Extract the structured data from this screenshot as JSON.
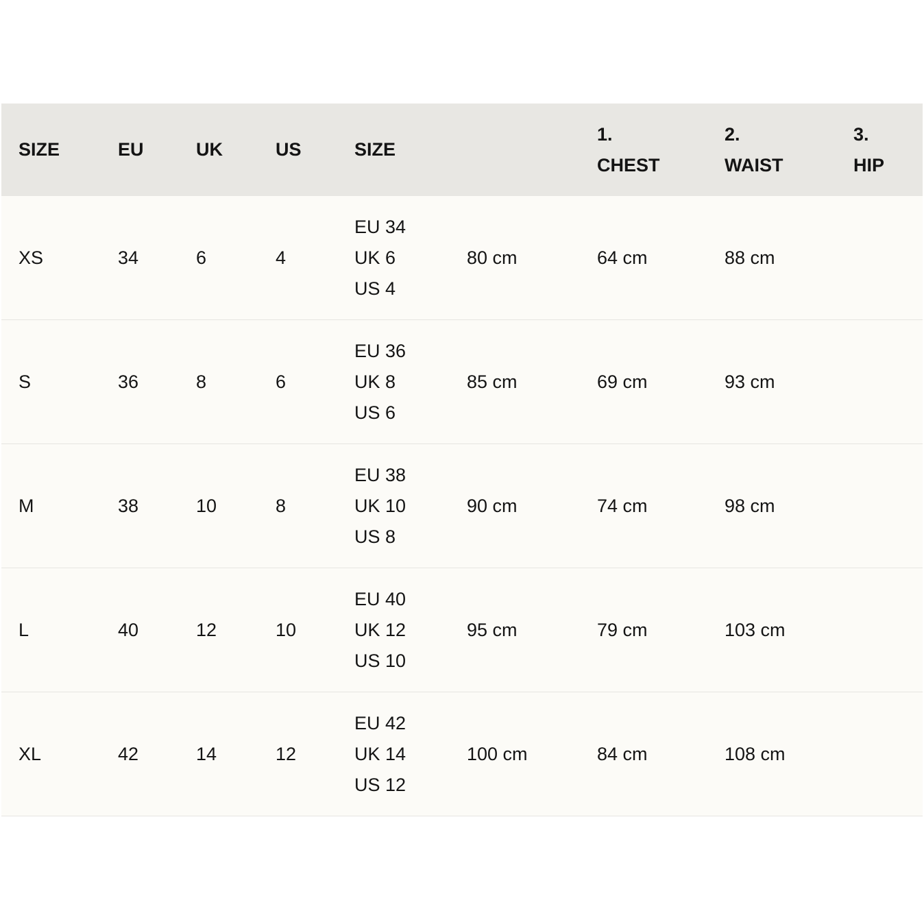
{
  "header": {
    "size": "SIZE",
    "eu": "EU",
    "uk": "UK",
    "us": "US",
    "size_conv": "SIZE",
    "chest_num": "1.",
    "chest": "CHEST",
    "waist_num": "2.",
    "waist": "WAIST",
    "hip_num": "3.",
    "hip": "HIP"
  },
  "rows": [
    {
      "size": "XS",
      "eu": "34",
      "uk": "6",
      "us": "4",
      "conv_eu": "EU 34",
      "conv_uk": "UK 6",
      "conv_us": "US 4",
      "m1": "80 cm",
      "m2": "64 cm",
      "m3": "88 cm"
    },
    {
      "size": "S",
      "eu": "36",
      "uk": "8",
      "us": "6",
      "conv_eu": "EU 36",
      "conv_uk": "UK 8",
      "conv_us": "US 6",
      "m1": "85 cm",
      "m2": "69 cm",
      "m3": "93 cm"
    },
    {
      "size": "M",
      "eu": "38",
      "uk": "10",
      "us": "8",
      "conv_eu": "EU 38",
      "conv_uk": "UK 10",
      "conv_us": "US 8",
      "m1": "90 cm",
      "m2": "74 cm",
      "m3": "98 cm"
    },
    {
      "size": "L",
      "eu": "40",
      "uk": "12",
      "us": "10",
      "conv_eu": "EU 40",
      "conv_uk": "UK 12",
      "conv_us": "US 10",
      "m1": "95 cm",
      "m2": "79 cm",
      "m3": "103 cm"
    },
    {
      "size": "XL",
      "eu": "42",
      "uk": "14",
      "us": "12",
      "conv_eu": "EU 42",
      "conv_uk": "UK 14",
      "conv_us": "US 12",
      "m1": "100 cm",
      "m2": "84 cm",
      "m3": "108 cm"
    }
  ]
}
